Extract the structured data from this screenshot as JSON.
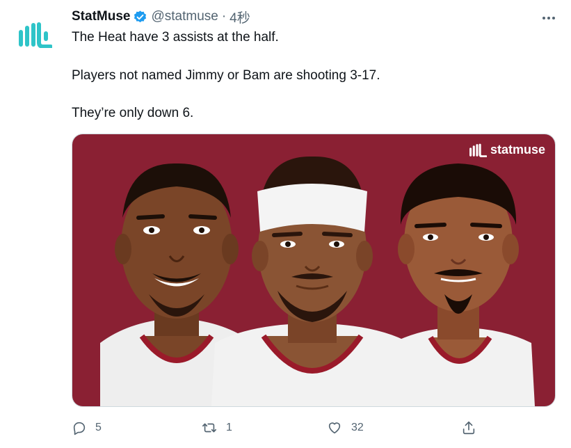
{
  "tweet": {
    "author": {
      "display_name": "StatMuse",
      "handle": "@statmuse",
      "separator": "·",
      "timestamp": "4秒",
      "avatar_icon": "statmuse-logo-icon",
      "verified_icon": "verified-badge-icon"
    },
    "lines": [
      "The Heat have 3 assists at the half.",
      "Players not named Jimmy or Bam are shooting 3-17.",
      "They’re only down 6."
    ],
    "media": {
      "watermark": "statmuse",
      "background_color": "#8a2033",
      "players": [
        {
          "skin": "#7a4528",
          "hair": "#1c0f08"
        },
        {
          "skin": "#8a5434",
          "hair": "#2a150c"
        },
        {
          "skin": "#9a5a38",
          "hair": "#1a0c06"
        }
      ]
    },
    "actions": {
      "reply": {
        "icon": "reply-icon",
        "count": "5"
      },
      "retweet": {
        "icon": "retweet-icon",
        "count": "1"
      },
      "like": {
        "icon": "heart-icon",
        "count": "32"
      },
      "share": {
        "icon": "share-icon"
      }
    },
    "colors": {
      "text": "#0f1419",
      "secondary": "#536471",
      "verified": "#1d9bf0",
      "brand": "#2ec4c8"
    }
  }
}
